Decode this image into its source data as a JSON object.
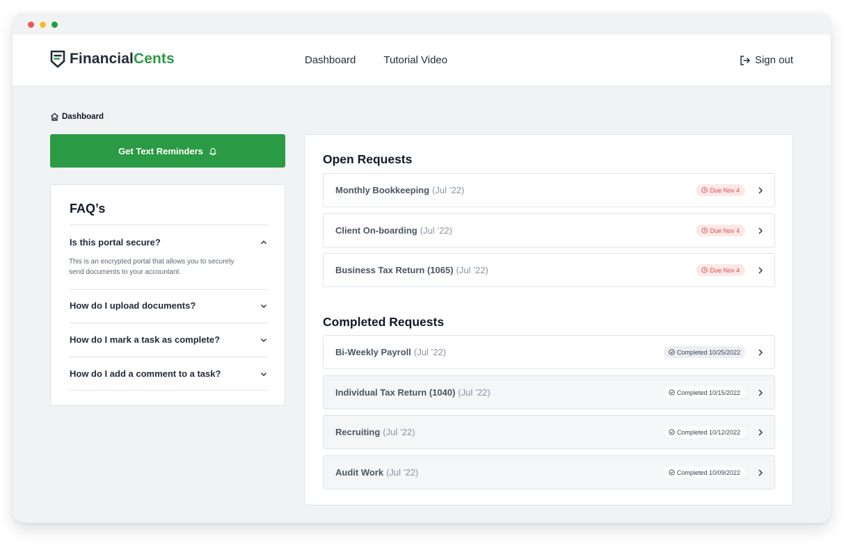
{
  "brand": {
    "name_part1": "Financial",
    "name_part2": "Cents",
    "accent_color": "#2a9a44"
  },
  "nav": {
    "links": [
      {
        "label": "Dashboard"
      },
      {
        "label": "Tutorial Video"
      }
    ],
    "signout_label": "Sign out"
  },
  "breadcrumb": {
    "label": "Dashboard",
    "icon": "home-icon"
  },
  "reminder_button": {
    "label": "Get Text Reminders",
    "icon": "bell-icon"
  },
  "faq": {
    "title": "FAQ’s",
    "items": [
      {
        "question": "Is this portal secure?",
        "expanded": true,
        "answer": "This is an encrypted portal that allows you to securely send documents to your accountant."
      },
      {
        "question": "How do I upload documents?",
        "expanded": false
      },
      {
        "question": "How do I mark a task as complete?",
        "expanded": false
      },
      {
        "question": "How do I add a comment to a task?",
        "expanded": false
      }
    ]
  },
  "open_requests": {
    "title": "Open Requests",
    "items": [
      {
        "name": "Monthly Bookkeeping",
        "period": "(Jul ’22)",
        "status": "Due Nov 4"
      },
      {
        "name": "Client On-boarding",
        "period": "(Jul ’22)",
        "status": "Due Nov 4"
      },
      {
        "name": "Business Tax Return (1065)",
        "period": "(Jul ’22)",
        "status": "Due Nov 4"
      }
    ]
  },
  "completed_requests": {
    "title": "Completed Requests",
    "items": [
      {
        "name": "Bi-Weekly Payroll",
        "period": "(Jul ’22)",
        "status": "Completed 10/25/2022"
      },
      {
        "name": "Individual Tax Return (1040)",
        "period": "(Jul ’22)",
        "status": "Completed 10/15/2022"
      },
      {
        "name": "Recruiting",
        "period": "(Jul ’22)",
        "status": "Completed 10/12/2022"
      },
      {
        "name": "Audit Work",
        "period": "(Jul ’22)",
        "status": "Completed 10/09/2022"
      }
    ]
  }
}
